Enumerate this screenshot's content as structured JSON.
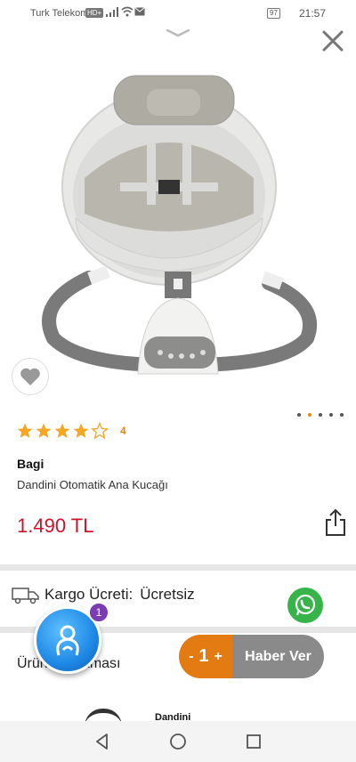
{
  "status_bar": {
    "carrier": "Turk Telekom",
    "network_badge": "HD+",
    "battery": "97",
    "time": "21:57"
  },
  "product": {
    "image_alt": "baby swing / automatic rocker",
    "rating_stars": 4,
    "rating_max": 5,
    "rating_value": "4",
    "brand": "Bagi",
    "name": "Dandini Otomatik Ana Kucağı",
    "price": "1.490 TL",
    "gallery_dots": 5,
    "gallery_active": 1
  },
  "shipping": {
    "label": "Kargo Ücreti:",
    "value": "Ücretsiz"
  },
  "section": {
    "title": "Ürün Açıklaması"
  },
  "assistant": {
    "badge_count": "1"
  },
  "cart": {
    "minus": "-",
    "quantity": "1",
    "plus": "+",
    "notify_label": "Haber Ver"
  },
  "related": {
    "name": "Dandini"
  },
  "colors": {
    "price": "#d0122a",
    "star": "#f5a623",
    "quantity_bg": "#e37a12",
    "notify_bg": "#8a8a8a",
    "whatsapp": "#37b449",
    "assistant_badge": "#7b3bb3"
  },
  "icons": [
    "chevron-down-icon",
    "close-icon",
    "heart-icon",
    "star-icon",
    "share-icon",
    "truck-icon",
    "whatsapp-icon",
    "assistant-icon",
    "back-icon",
    "home-icon",
    "recents-icon"
  ]
}
